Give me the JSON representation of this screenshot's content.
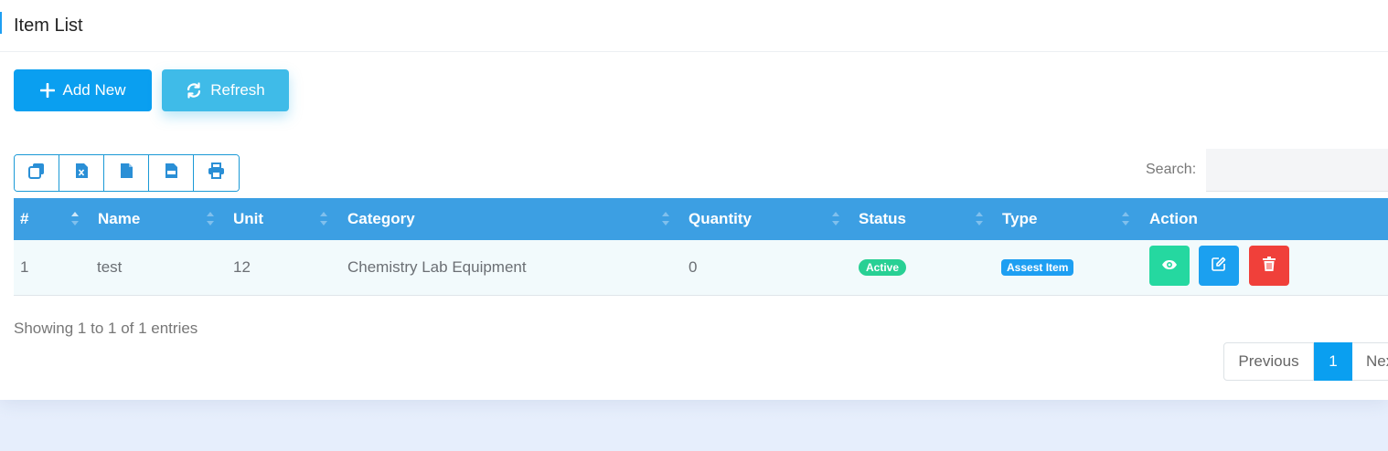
{
  "page": {
    "title": "Item List"
  },
  "toolbar": {
    "add_label": "Add New",
    "refresh_label": "Refresh"
  },
  "export_buttons": [
    "copy-icon",
    "excel-icon",
    "csv-icon",
    "pdf-icon",
    "print-icon"
  ],
  "search": {
    "label": "Search:",
    "value": ""
  },
  "table": {
    "headers": [
      "#",
      "Name",
      "Unit",
      "Category",
      "Quantity",
      "Status",
      "Type",
      "Action"
    ],
    "rows": [
      {
        "no": "1",
        "name": "test",
        "unit": "12",
        "category": "Chemistry Lab Equipment",
        "quantity": "0",
        "status": "Active",
        "type": "Assest Item"
      }
    ]
  },
  "footer": {
    "info": "Showing 1 to 1 of 1 entries",
    "pagination": {
      "previous": "Previous",
      "current": "1",
      "next": "Next"
    }
  },
  "colors": {
    "primary": "#0a9ff0",
    "header": "#3c9fe3",
    "success": "#28d094",
    "danger": "#f0403a"
  }
}
